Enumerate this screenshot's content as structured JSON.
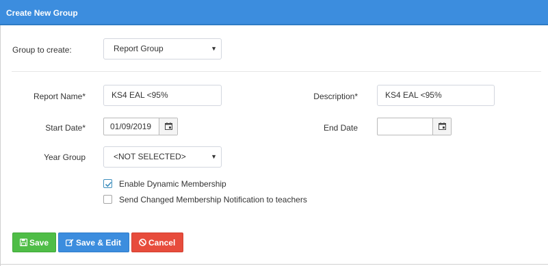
{
  "header": {
    "title": "Create New Group"
  },
  "group_to_create": {
    "label": "Group to create:",
    "value": "Report Group"
  },
  "report_name": {
    "label": "Report Name*",
    "value": "KS4 EAL <95%"
  },
  "description": {
    "label": "Description*",
    "value": "KS4 EAL <95%"
  },
  "start_date": {
    "label": "Start Date*",
    "value": "01/09/2019"
  },
  "end_date": {
    "label": "End Date",
    "value": ""
  },
  "year_group": {
    "label": "Year Group",
    "value": "<NOT SELECTED>"
  },
  "checkboxes": [
    {
      "label": "Enable Dynamic Membership",
      "checked": true
    },
    {
      "label": "Send Changed Membership Notification to teachers",
      "checked": false
    }
  ],
  "buttons": {
    "save": "Save",
    "save_edit": "Save & Edit",
    "cancel": "Cancel"
  },
  "colors": {
    "header": "#3c8dde",
    "save": "#4fbd47",
    "save_edit": "#3c8dde",
    "cancel": "#e74c3c"
  }
}
